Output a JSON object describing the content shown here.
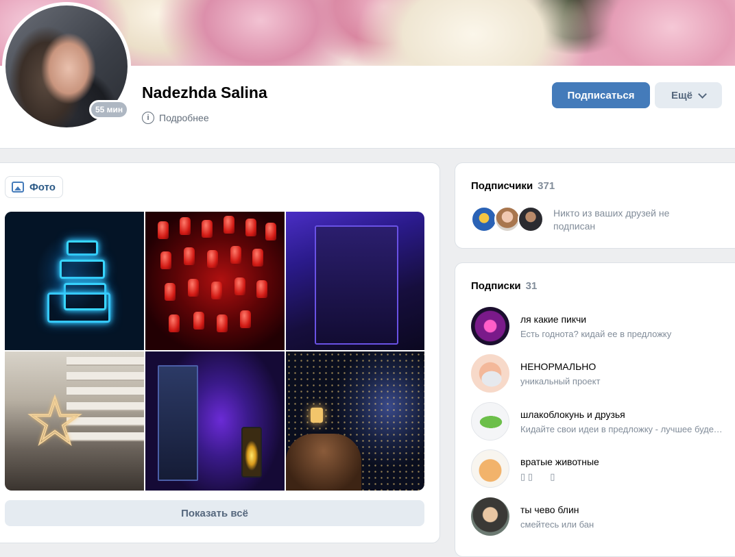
{
  "profile": {
    "name": "Nadezhda Salina",
    "status_time": "55 мин",
    "details_label": "Подробнее",
    "subscribe_label": "Подписаться",
    "more_label": "Ещё"
  },
  "photos": {
    "tab_label": "Фото",
    "show_all_label": "Показать всё",
    "items": [
      "neon-sign",
      "red-lucky-cats",
      "purple-room",
      "star-lamp",
      "neon-door-lantern",
      "lounge-window"
    ]
  },
  "followers": {
    "title": "Подписчики",
    "count": "371",
    "note": "Никто из ваших друзей не подписан"
  },
  "subscriptions": {
    "title": "Подписки",
    "count": "31",
    "items": [
      {
        "name": "ля какие пикчи",
        "desc": "Есть годнота? кидай ее в предложку"
      },
      {
        "name": "НЕНОРМАЛЬНО",
        "desc": "уникальный проект"
      },
      {
        "name": "шлакоблокунь и друзья",
        "desc": "Кидайте свои идеи в предложку - лучшее будет опубликовано"
      },
      {
        "name": "вратые животные",
        "desc": "▯ ▯       ▯"
      },
      {
        "name": "ты чево блин",
        "desc": "смейтесь или бан"
      }
    ]
  },
  "colors": {
    "accent": "#447bba",
    "link": "#2a5885",
    "secondary_text": "#818c99",
    "background": "#edeef0"
  }
}
